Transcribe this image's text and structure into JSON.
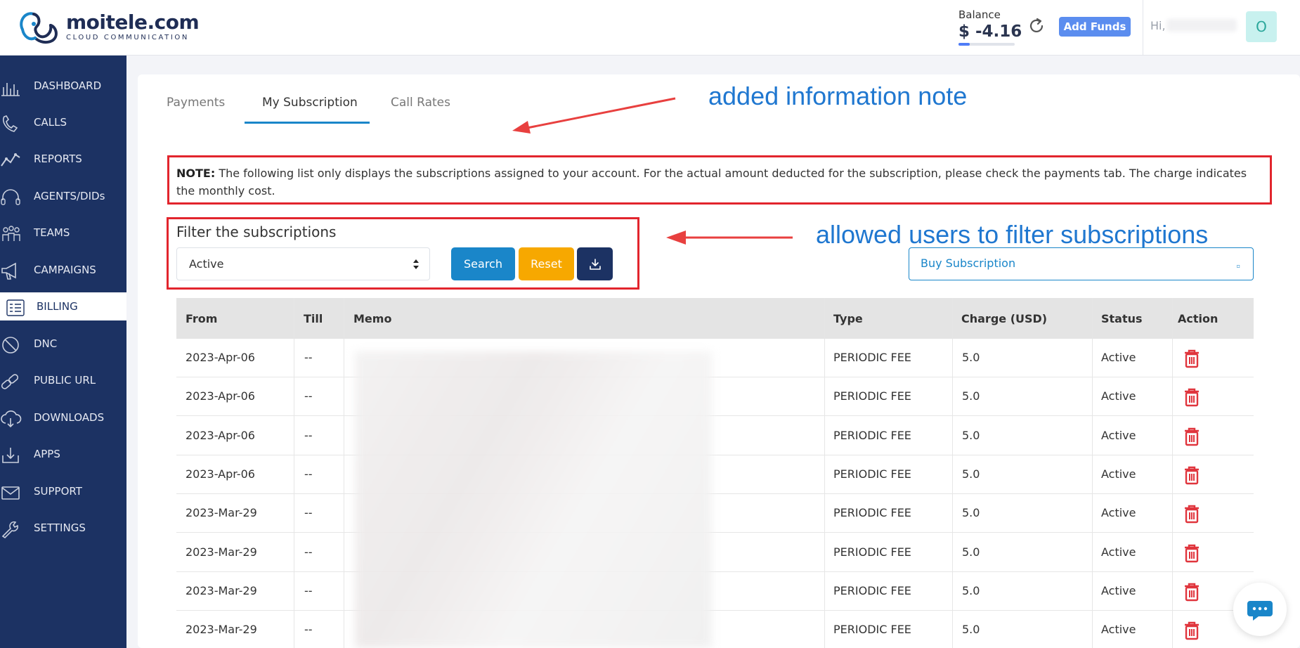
{
  "header": {
    "logo_name": "moitele.com",
    "logo_sub": "CLOUD COMMUNICATION",
    "balance_label": "Balance",
    "balance_value": "$ -4.16",
    "balance_fill_fraction": 0.2,
    "add_funds_label": "Add Funds",
    "greeting": "Hi,",
    "avatar_initial": "O"
  },
  "sidebar": {
    "items": [
      {
        "label": "DASHBOARD",
        "icon": "dashboard-icon"
      },
      {
        "label": "CALLS",
        "icon": "phone-icon"
      },
      {
        "label": "REPORTS",
        "icon": "reports-icon"
      },
      {
        "label": "AGENTS/DIDs",
        "icon": "headset-icon"
      },
      {
        "label": "TEAMS",
        "icon": "teams-icon"
      },
      {
        "label": "CAMPAIGNS",
        "icon": "megaphone-icon"
      },
      {
        "label": "BILLING",
        "icon": "billing-icon"
      },
      {
        "label": "DNC",
        "icon": "block-icon"
      },
      {
        "label": "PUBLIC URL",
        "icon": "link-icon"
      },
      {
        "label": "DOWNLOADS",
        "icon": "cloud-download-icon"
      },
      {
        "label": "APPS",
        "icon": "apps-icon"
      },
      {
        "label": "SUPPORT",
        "icon": "mail-icon"
      },
      {
        "label": "SETTINGS",
        "icon": "wrench-icon"
      }
    ],
    "active": "BILLING"
  },
  "tabs": [
    {
      "label": "Payments"
    },
    {
      "label": "My Subscription"
    },
    {
      "label": "Call Rates"
    }
  ],
  "annotations": {
    "note_added": "added information note",
    "filter_added": "allowed users to filter subscriptions"
  },
  "note": {
    "prefix": "NOTE:",
    "text": " The following list only displays the subscriptions assigned to your account. For the actual amount deducted for the subscription, please check the payments tab. The charge indicates the monthly cost."
  },
  "filter": {
    "title": "Filter the subscriptions",
    "selected": "Active",
    "search_label": "Search",
    "reset_label": "Reset"
  },
  "buy": {
    "label": "Buy Subscription"
  },
  "table": {
    "columns": [
      "From",
      "Till",
      "Memo",
      "Type",
      "Charge (USD)",
      "Status",
      "Action"
    ],
    "rows": [
      {
        "from": "2023-Apr-06",
        "till": "--",
        "type": "PERIODIC FEE",
        "charge": "5.0",
        "status": "Active"
      },
      {
        "from": "2023-Apr-06",
        "till": "--",
        "type": "PERIODIC FEE",
        "charge": "5.0",
        "status": "Active"
      },
      {
        "from": "2023-Apr-06",
        "till": "--",
        "type": "PERIODIC FEE",
        "charge": "5.0",
        "status": "Active"
      },
      {
        "from": "2023-Apr-06",
        "till": "--",
        "type": "PERIODIC FEE",
        "charge": "5.0",
        "status": "Active"
      },
      {
        "from": "2023-Mar-29",
        "till": "--",
        "type": "PERIODIC FEE",
        "charge": "5.0",
        "status": "Active"
      },
      {
        "from": "2023-Mar-29",
        "till": "--",
        "type": "PERIODIC FEE",
        "charge": "5.0",
        "status": "Active"
      },
      {
        "from": "2023-Mar-29",
        "till": "--",
        "type": "PERIODIC FEE",
        "charge": "5.0",
        "status": "Active"
      },
      {
        "from": "2023-Mar-29",
        "till": "--",
        "type": "PERIODIC FEE",
        "charge": "5.0",
        "status": "Active"
      }
    ]
  },
  "colors": {
    "sidebar_bg": "#1c3263",
    "accent_blue": "#1a86c9",
    "reset_orange": "#f7a800",
    "annotation_red": "#e2252d",
    "annotation_text_blue": "#1f77d0",
    "trash_red": "#e0353d"
  }
}
